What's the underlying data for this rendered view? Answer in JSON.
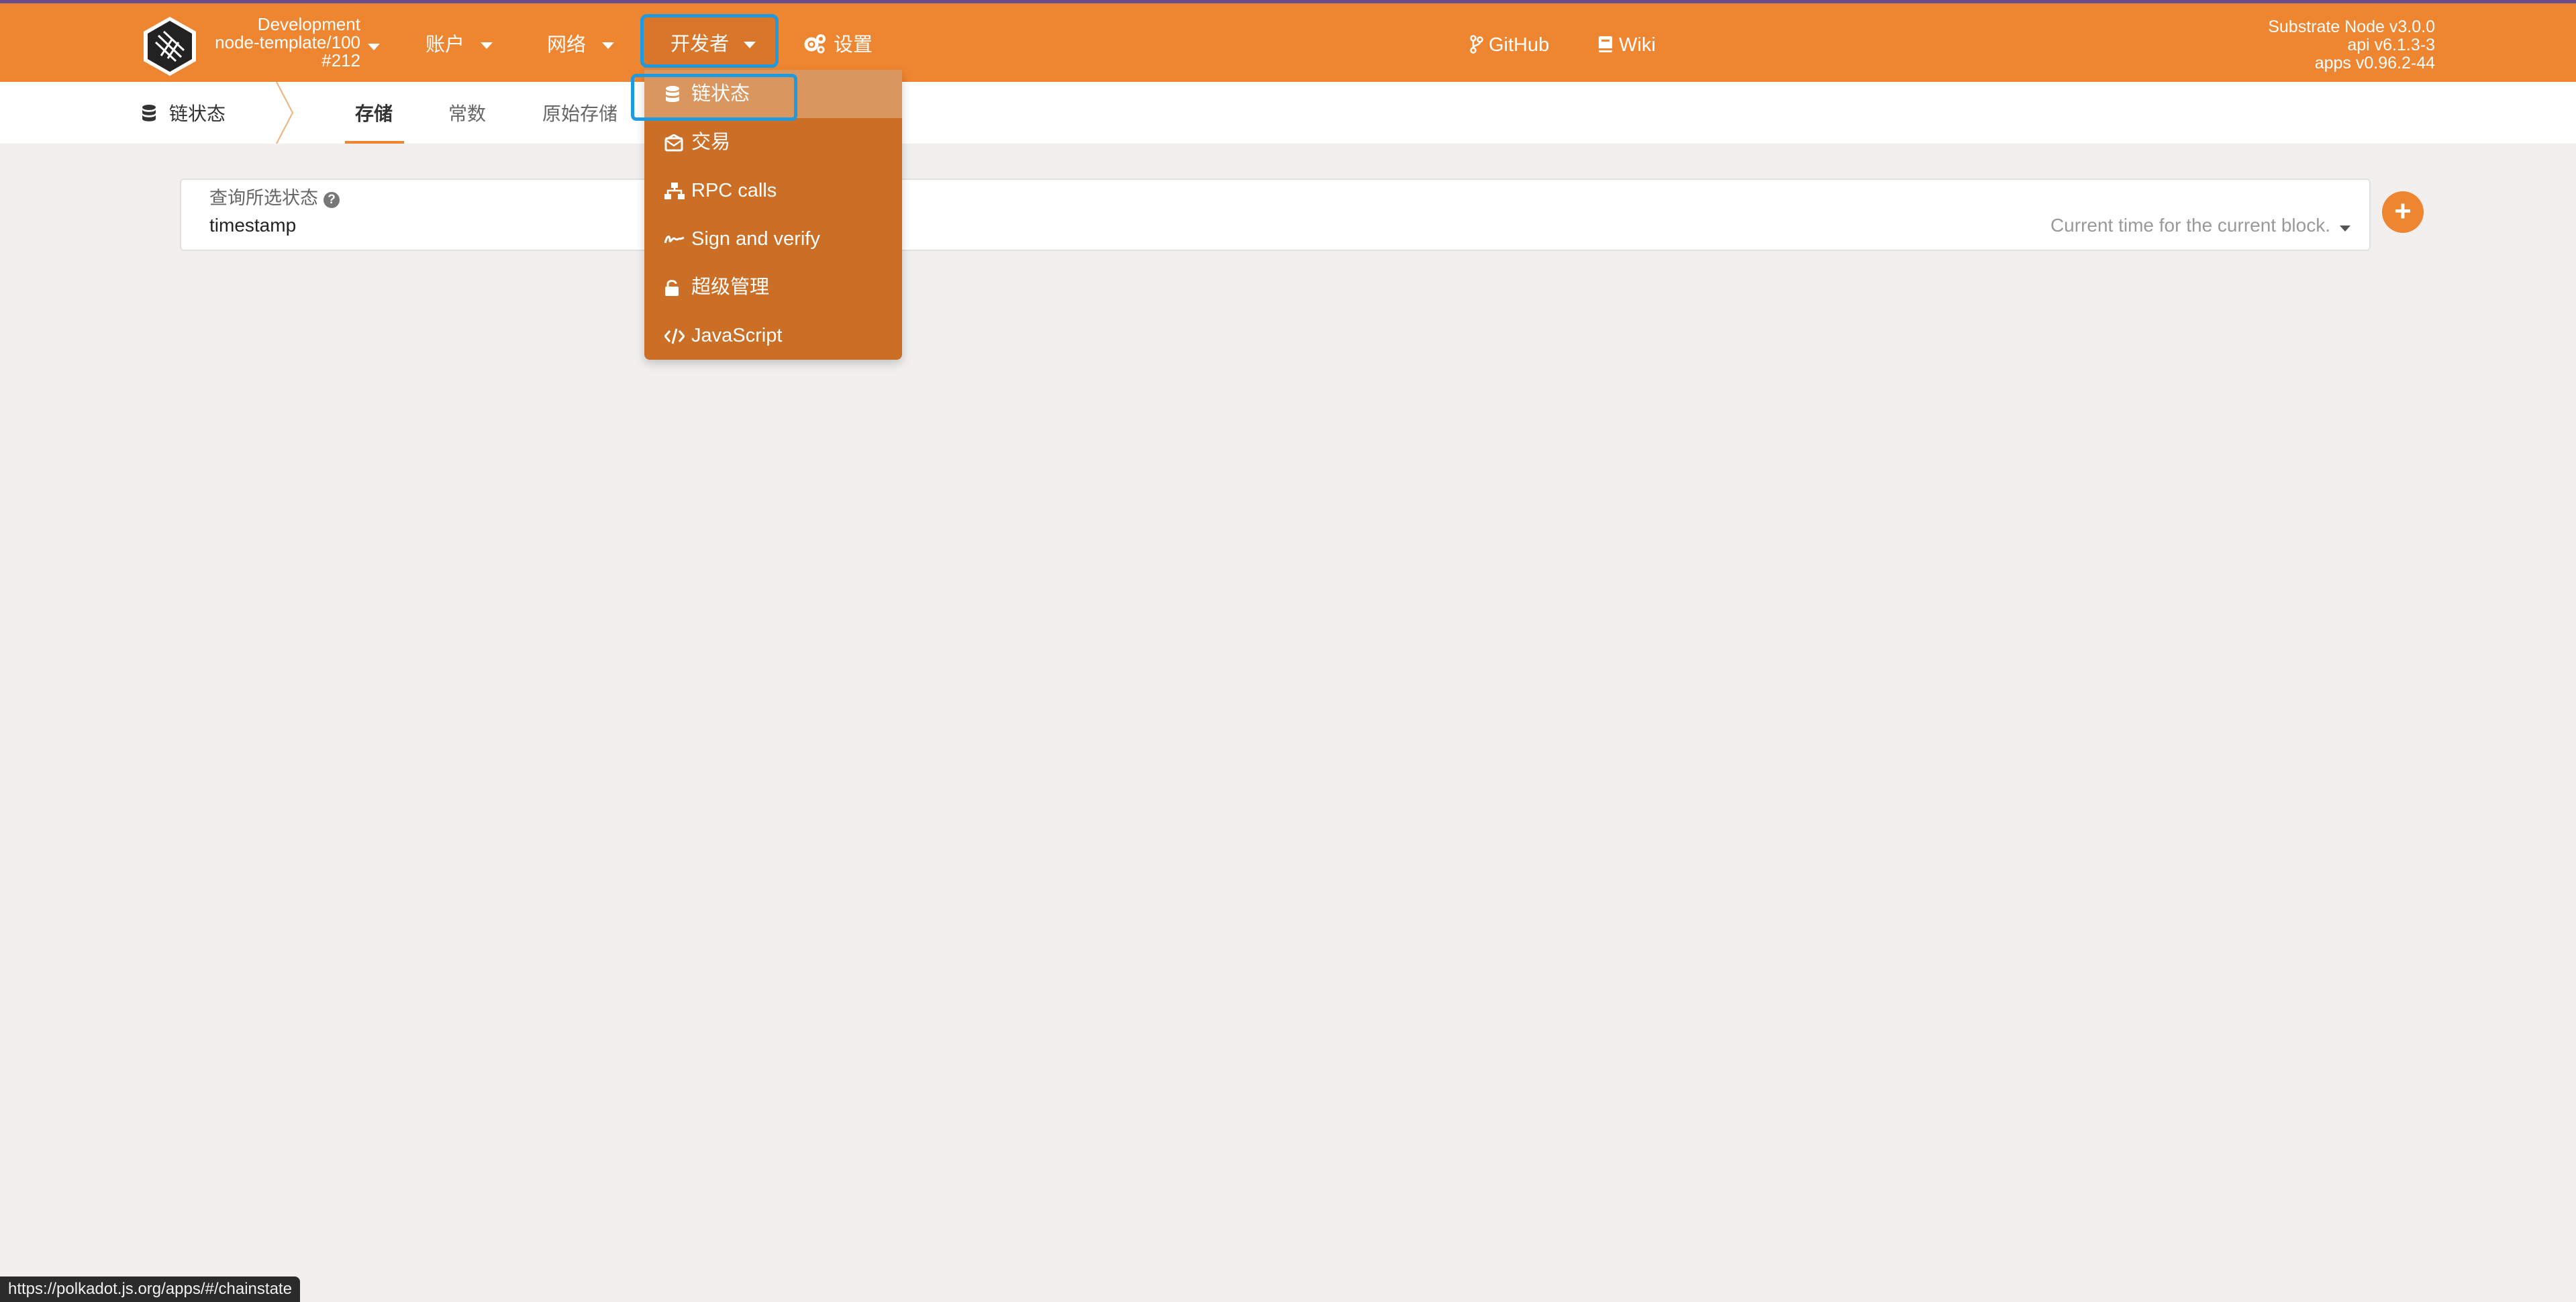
{
  "header": {
    "chain": {
      "line1": "Development",
      "line2": "node-template/100",
      "line3": "#212"
    },
    "nav": {
      "accounts": "账户",
      "network": "网络",
      "developer": "开发者",
      "settings": "设置"
    },
    "links": {
      "github": "GitHub",
      "wiki": "Wiki"
    },
    "versions": {
      "node": "Substrate Node v3.0.0",
      "api": "api v6.1.3-3",
      "apps": "apps v0.96.2-44"
    }
  },
  "subnav": {
    "section_title": "链状态",
    "tabs": [
      {
        "label": "存储",
        "active": true
      },
      {
        "label": "常数",
        "active": false
      },
      {
        "label": "原始存储",
        "active": false
      }
    ]
  },
  "query": {
    "label": "查询所选状态",
    "value": "timestamp",
    "description": "Current time for the current block.",
    "add_label": "+"
  },
  "developer_menu": {
    "items": [
      {
        "label": "链状态",
        "icon": "database-icon",
        "active": true
      },
      {
        "label": "交易",
        "icon": "envelope-open-icon",
        "active": false
      },
      {
        "label": "RPC calls",
        "icon": "network-wired-icon",
        "active": false
      },
      {
        "label": "Sign and verify",
        "icon": "signature-icon",
        "active": false
      },
      {
        "label": "超级管理",
        "icon": "unlock-icon",
        "active": false
      },
      {
        "label": "JavaScript",
        "icon": "code-icon",
        "active": false
      }
    ]
  },
  "status_bar": {
    "url": "https://polkadot.js.org/apps/#/chainstate"
  },
  "colors": {
    "brand_orange": "#ee8530",
    "dropdown_bg": "#cb6e26",
    "dropdown_active": "#d9965f",
    "focus_ring": "#1e9be0",
    "page_bg": "#f1f0ee"
  }
}
